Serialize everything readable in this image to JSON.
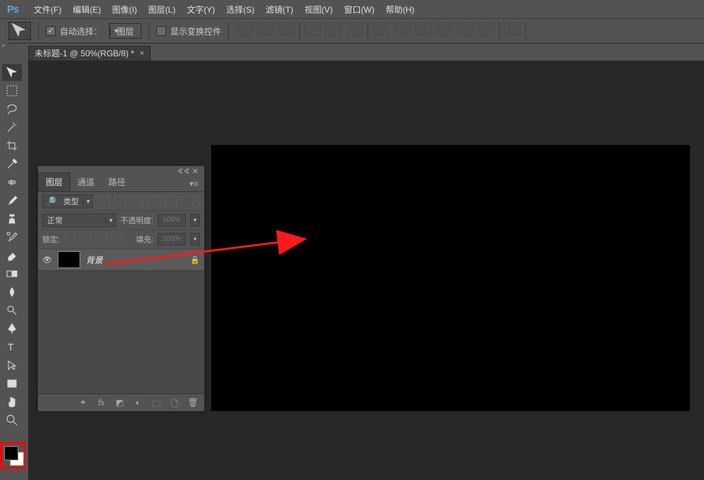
{
  "app": {
    "logo": "Ps"
  },
  "menubar": {
    "items": [
      "文件(F)",
      "编辑(E)",
      "图像(I)",
      "图层(L)",
      "文字(Y)",
      "选择(S)",
      "滤镜(T)",
      "视图(V)",
      "窗口(W)",
      "帮助(H)"
    ]
  },
  "optionsbar": {
    "auto_select_label": "自动选择：",
    "auto_select_value": "图层",
    "show_transform_label": "显示变换控件"
  },
  "tools": {
    "names": [
      "move",
      "marquee",
      "lasso",
      "magic-wand",
      "crop",
      "eyedropper",
      "healing",
      "brush",
      "clone",
      "history-brush",
      "eraser",
      "gradient",
      "blur",
      "dodge",
      "pen",
      "type",
      "path-select",
      "rectangle",
      "hand",
      "zoom"
    ]
  },
  "document": {
    "tab_title": "未标题-1 @ 50%(RGB/8) *"
  },
  "panel": {
    "tabs": [
      "图层",
      "通道",
      "路径"
    ],
    "active_tab": 0,
    "filter_label": "类型",
    "blend_mode": "正常",
    "opacity_label": "不透明度:",
    "opacity_value": "100%",
    "lock_label": "锁定:",
    "fill_label": "填充:",
    "fill_value": "100%",
    "layers": [
      {
        "name": "背景",
        "visible": true,
        "locked": true
      }
    ]
  },
  "annotation": {
    "color": "#ff1a1a"
  }
}
